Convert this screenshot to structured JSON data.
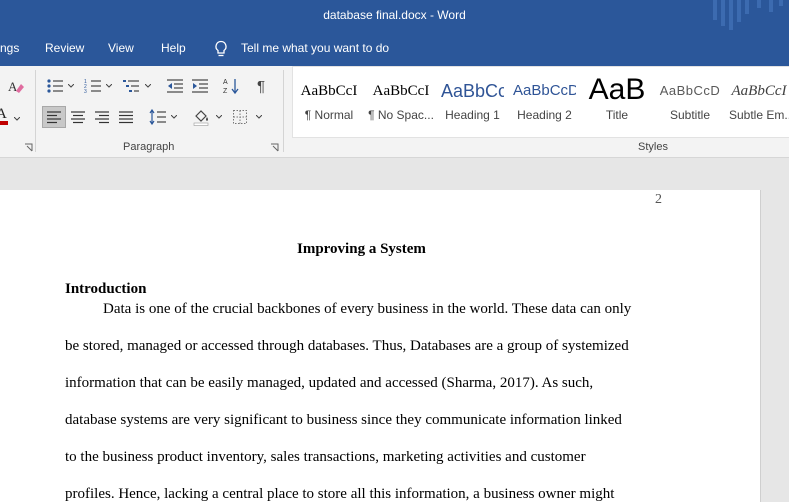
{
  "window": {
    "title": "database final.docx  -  Word"
  },
  "tabs": [
    {
      "label": "ngs"
    },
    {
      "label": "Review"
    },
    {
      "label": "View"
    },
    {
      "label": "Help"
    },
    {
      "label": "Tell me what you want to do"
    }
  ],
  "ribbon": {
    "paragraph_label": "Paragraph",
    "styles_label": "Styles",
    "font_color_glyph": "A",
    "styles": [
      {
        "sample": "AaBbCcI",
        "name": "¶ Normal"
      },
      {
        "sample": "AaBbCcI",
        "name": "¶ No Spac..."
      },
      {
        "sample": "AaBbCc",
        "name": "Heading 1"
      },
      {
        "sample": "AaBbCcD",
        "name": "Heading 2"
      },
      {
        "sample": "AaB",
        "name": "Title"
      },
      {
        "sample": "AaBbCcD",
        "name": "Subtitle"
      },
      {
        "sample": "AaBbCcI",
        "name": "Subtle Em..."
      }
    ],
    "colors": {
      "font_color_bar": "#c00000",
      "titlebar": "#2b579a",
      "style_heading": "#2f5496"
    }
  },
  "document": {
    "page_number": "2",
    "title": "Improving a System",
    "heading": "Introduction",
    "lines": [
      "Data is one of the crucial backbones of every business in the world. These data can only",
      "be stored, managed or accessed through databases. Thus, Databases are a group of systemized",
      "information that can be easily managed, updated and accessed (Sharma, 2017). As such,",
      "database systems are very significant to business since they communicate information linked",
      "to the business product inventory, sales transactions, marketing activities and customer",
      "profiles. Hence, lacking a central place to store all this information, a business owner might"
    ]
  }
}
